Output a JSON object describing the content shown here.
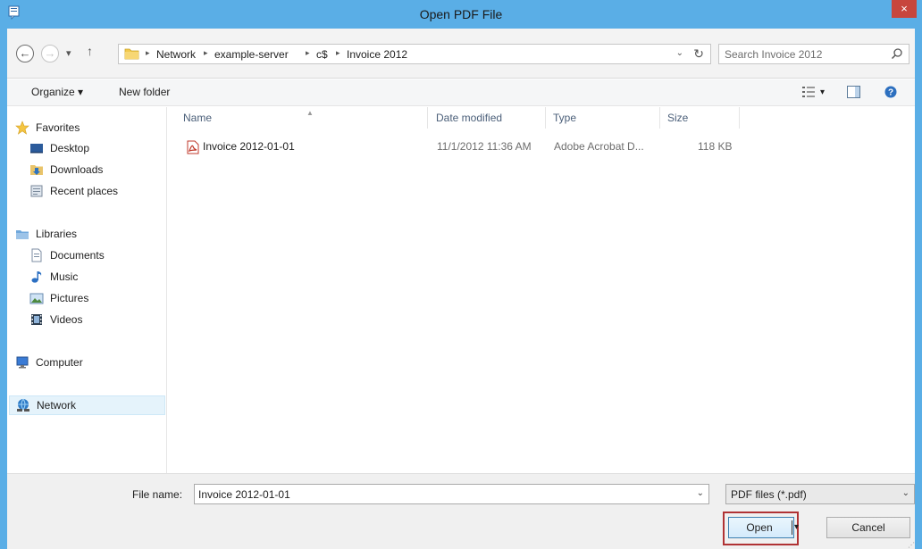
{
  "window": {
    "title": "Open PDF File",
    "close_symbol": "×"
  },
  "navigation": {
    "back_symbol": "←",
    "forward_symbol": "→",
    "recent_symbol": "▾",
    "up_symbol": "↑"
  },
  "address": {
    "breadcrumbs": [
      "Network",
      "example-server",
      "c$",
      "Invoice 2012"
    ],
    "separator": "▸",
    "dropdown_symbol": "⌄",
    "refresh_symbol": "↻"
  },
  "search": {
    "placeholder": "Search Invoice 2012"
  },
  "toolbar": {
    "organize_label": "Organize ▾",
    "new_folder_label": "New folder",
    "view_dropdown_symbol": "▾"
  },
  "sidebar": {
    "favorites": {
      "label": "Favorites",
      "items": [
        {
          "label": "Desktop",
          "icon": "desktop-icon"
        },
        {
          "label": "Downloads",
          "icon": "downloads-folder-icon"
        },
        {
          "label": "Recent places",
          "icon": "recent-places-icon"
        }
      ]
    },
    "libraries": {
      "label": "Libraries",
      "items": [
        {
          "label": "Documents",
          "icon": "document-icon"
        },
        {
          "label": "Music",
          "icon": "music-icon"
        },
        {
          "label": "Pictures",
          "icon": "pictures-icon"
        },
        {
          "label": "Videos",
          "icon": "video-icon"
        }
      ]
    },
    "computer": "Computer",
    "network": "Network"
  },
  "file_list": {
    "columns": [
      "Name",
      "Date modified",
      "Type",
      "Size"
    ],
    "rows": [
      {
        "name": "Invoice 2012-01-01",
        "date_modified": "11/1/2012 11:36 AM",
        "type": "Adobe Acrobat D...",
        "size": "118 KB"
      }
    ]
  },
  "bottom": {
    "file_name_label": "File name:",
    "file_name_value": "Invoice 2012-01-01",
    "file_type_value": "PDF files (*.pdf)",
    "dropdown_symbol": "⌄",
    "open_label": "Open",
    "open_split_symbol": "▾",
    "cancel_label": "Cancel"
  },
  "colors": {
    "window_frame": "#5aaee6",
    "close_button": "#c7463d",
    "open_highlight": "#b03234",
    "selected_nav": "#e5f3fb"
  }
}
